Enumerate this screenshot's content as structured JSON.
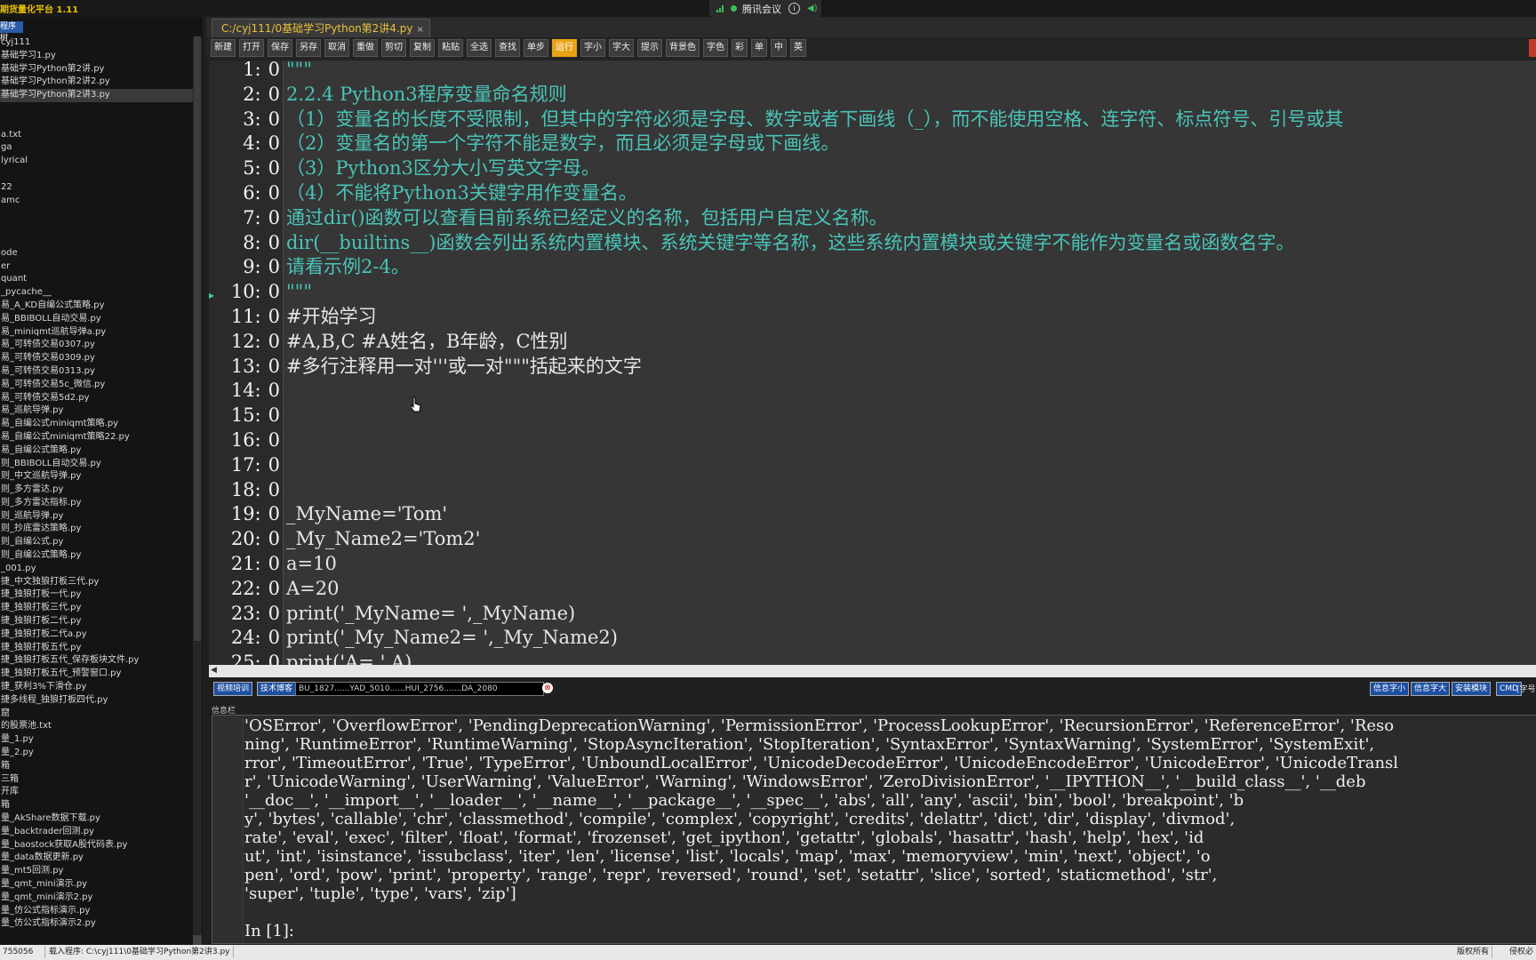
{
  "app": {
    "title": "期货量化平台 1.11",
    "meeting": {
      "name": "腾讯会议",
      "info_icon": "info-icon"
    }
  },
  "sidebar": {
    "header": "程序树",
    "files": [
      "cyj111",
      "基础学习1.py",
      "基础学习Python第2讲.py",
      "基础学习Python第2讲2.py",
      "基础学习Python第2讲3.py",
      "",
      "",
      "a.txt",
      "ga",
      "lyrical",
      "",
      "22",
      "amc",
      "",
      "",
      "",
      "ode",
      "er",
      "quant",
      "_pycache__",
      "易_A_KD自编公式策略.py",
      "易_BBIBOLL自动交易.py",
      "易_miniqmt巡航导弹a.py",
      "易_可转债交易0307.py",
      "易_可转债交易0309.py",
      "易_可转债交易0313.py",
      "易_可转债交易5c_微信.py",
      "易_可转债交易5d2.py",
      "易_巡航导弹.py",
      "易_自编公式miniqmt策略.py",
      "易_自编公式miniqmt策略22.py",
      "易_自编公式策略.py",
      "则_BBIBOLL自动交易.py",
      "则_中文巡航导弹.py",
      "则_多方雷达.py",
      "则_多方雷达指标.py",
      "则_巡航导弹.py",
      "则_抄底雷达策略.py",
      "则_自编公式.py",
      "则_自编公式策略.py",
      "_001.py",
      "捷_中文独狼打板三代.py",
      "捷_独狼打板一代.py",
      "捷_独狼打板三代.py",
      "捷_独狼打板二代.py",
      "捷_独狼打板二代a.py",
      "捷_独狼打板五代.py",
      "捷_独狼打板五代_保存板块文件.py",
      "捷_独狼打板五代_预警窗口.py",
      "捷_获利3%下滑仓.py",
      "捷多线程_独狼打板四代.py",
      "窟",
      "的股票池.txt",
      "量_1.py",
      "量_2.py",
      "箱",
      "三箱",
      "开库",
      "箱",
      "量_AkShare数据下载.py",
      "量_backtrader回测.py",
      "量_baostock获取A股代码表.py",
      "量_data数据更新.py",
      "量_mt5回测.py",
      "量_qmt_mini演示.py",
      "量_qmt_mini演示2.py",
      "量_仿公式指标演示.py",
      "量_仿公式指标演示2.py"
    ],
    "selected_index": 4
  },
  "tab": {
    "label": "C:/cyj111/0基础学习Python第2讲4.py",
    "close": "×"
  },
  "toolbar": {
    "buttons": [
      "新建",
      "打开",
      "保存",
      "另存",
      "取消",
      "重做",
      "剪切",
      "复制",
      "粘贴",
      "全选",
      "查找",
      "单步",
      "运行",
      "字小",
      "字大",
      "提示",
      "背景色",
      "字色",
      "彩",
      "单",
      "中",
      "英"
    ],
    "active": "运行"
  },
  "editor": {
    "lines": [
      {
        "n": "1:",
        "v": "0",
        "text": "\"\"\"",
        "kind": "doc"
      },
      {
        "n": "2:",
        "v": "0",
        "text": "2.2.4    Python3程序变量命名规则",
        "kind": "doc"
      },
      {
        "n": "3:",
        "v": "0",
        "text": "（1）变量名的长度不受限制，但其中的字符必须是字母、数字或者下画线（_），而不能使用空格、连字符、标点符号、引号或其",
        "kind": "doc"
      },
      {
        "n": "4:",
        "v": "0",
        "text": "（2）变量名的第一个字符不能是数字，而且必须是字母或下画线。",
        "kind": "doc"
      },
      {
        "n": "5:",
        "v": "0",
        "text": "（3）Python3区分大小写英文字母。",
        "kind": "doc"
      },
      {
        "n": "6:",
        "v": "0",
        "text": "（4）不能将Python3关键字用作变量名。",
        "kind": "doc"
      },
      {
        "n": "7:",
        "v": "0",
        "text": "通过dir()函数可以查看目前系统已经定义的名称，包括用户自定义名称。",
        "kind": "doc"
      },
      {
        "n": "8:",
        "v": "0",
        "text": "dir(__builtins__)函数会列出系统内置模块、系统关键字等名称，这些系统内置模块或关键字不能作为变量名或函数名字。",
        "kind": "doc"
      },
      {
        "n": "9:",
        "v": "0",
        "text": "请看示例2-4。",
        "kind": "doc"
      },
      {
        "n": "10:",
        "v": "0",
        "text": "\"\"\"",
        "kind": "doc"
      },
      {
        "n": "11:",
        "v": "0",
        "text": "#开始学习",
        "kind": "comment"
      },
      {
        "n": "12:",
        "v": "0",
        "text": "#A,B,C    #A姓名，B年龄，C性别",
        "kind": "comment"
      },
      {
        "n": "13:",
        "v": "0",
        "text": "#多行注释用一对'''或一对\"\"\"括起来的文字",
        "kind": "comment"
      },
      {
        "n": "14:",
        "v": "0",
        "text": "",
        "kind": "var"
      },
      {
        "n": "15:",
        "v": "0",
        "text": "",
        "kind": "var"
      },
      {
        "n": "16:",
        "v": "0",
        "text": "",
        "kind": "var"
      },
      {
        "n": "17:",
        "v": "0",
        "text": "",
        "kind": "var"
      },
      {
        "n": "18:",
        "v": "0",
        "text": "",
        "kind": "var"
      },
      {
        "n": "19:",
        "v": "0",
        "text": "_MyName='Tom'",
        "kind": "str"
      },
      {
        "n": "20:",
        "v": "0",
        "text": "_My_Name2='Tom2'",
        "kind": "str"
      },
      {
        "n": "21:",
        "v": "0",
        "text": "a=10",
        "kind": "str"
      },
      {
        "n": "22:",
        "v": "0",
        "text": "A=20",
        "kind": "str"
      },
      {
        "n": "23:",
        "v": "0",
        "text": "print('_MyName= ',_MyName)",
        "kind": "str"
      },
      {
        "n": "24:",
        "v": "0",
        "text": "print('_My_Name2= ',_My_Name2)",
        "kind": "str"
      },
      {
        "n": "25:",
        "v": "0",
        "text": "print('A= ',A)",
        "kind": "str"
      }
    ]
  },
  "midbar": {
    "chip1": "视频培训",
    "chip2": "技术博客",
    "ticker": "BU_1827......YAD_5010......HUI_2756.......DA_2080",
    "right_buttons": [
      "信息字小",
      "信息字大",
      "安装模块",
      "CMD"
    ],
    "right_label": "[字号:"
  },
  "output": {
    "label": "信息栏",
    "lines": [
      "'OSError', 'OverflowError', 'PendingDeprecationWarning', 'PermissionError', 'ProcessLookupError', 'RecursionError', 'ReferenceError', 'Reso",
      "ning', 'RuntimeError', 'RuntimeWarning', 'StopAsyncIteration', 'StopIteration', 'SyntaxError', 'SyntaxWarning', 'SystemError', 'SystemExit',",
      "rror', 'TimeoutError', 'True', 'TypeError', 'UnboundLocalError', 'UnicodeDecodeError', 'UnicodeEncodeError', 'UnicodeError', 'UnicodeTransl",
      "r', 'UnicodeWarning', 'UserWarning', 'ValueError', 'Warning', 'WindowsError', 'ZeroDivisionError', '__IPYTHON__', '__build_class__', '__deb",
      "'__doc__', '__import__', '__loader__', '__name__', '__package__', '__spec__', 'abs', 'all', 'any', 'ascii', 'bin', 'bool', 'breakpoint', 'b",
      "y', 'bytes', 'callable', 'chr', 'classmethod', 'compile', 'complex', 'copyright', 'credits', 'delattr', 'dict', 'dir', 'display', 'divmod',",
      "rate', 'eval', 'exec', 'filter', 'float', 'format', 'frozenset', 'get_ipython', 'getattr', 'globals', 'hasattr', 'hash', 'help', 'hex', 'id",
      "ut', 'int', 'isinstance', 'issubclass', 'iter', 'len', 'license', 'list', 'locals', 'map', 'max', 'memoryview', 'min', 'next', 'object', 'o",
      "pen', 'ord', 'pow', 'print', 'property', 'range', 'repr', 'reversed', 'round', 'set', 'setattr', 'slice', 'sorted', 'staticmethod', 'str',",
      "'super', 'tuple', 'type', 'vars', 'zip']"
    ],
    "prompt": "In [1]:"
  },
  "status": {
    "left": "755056",
    "program": "载入程序: C:\\cyj111\\0基础学习Python第2讲3.py",
    "right1": "版权所有",
    "right2": "侵权必"
  }
}
